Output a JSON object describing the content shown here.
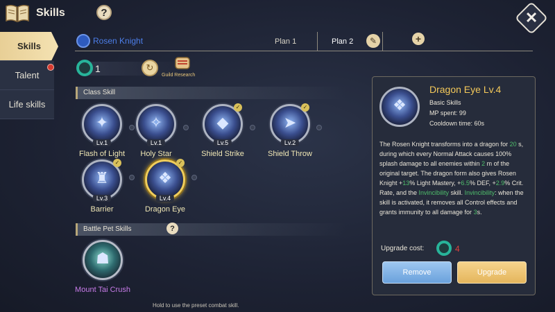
{
  "header": {
    "title": "Skills",
    "help": "?",
    "close": "✕"
  },
  "sidetabs": [
    {
      "label": "Skills"
    },
    {
      "label": "Talent"
    },
    {
      "label": "Life skills"
    }
  ],
  "planbar": {
    "class_name": "Rosen Knight",
    "plan1": "Plan 1",
    "plan2": "Plan 2",
    "edit": "✎",
    "add": "+"
  },
  "points": {
    "value": "1",
    "reset": "↻",
    "guild_label": "Guild Research"
  },
  "sections": {
    "class_skill": "Class Skill",
    "pet_skills": "Battle Pet Skills",
    "pet_help": "?"
  },
  "skills": [
    {
      "name": "Flash of Light",
      "level": "Lv.1",
      "glyph": "✦"
    },
    {
      "name": "Holy Star",
      "level": "Lv.1",
      "glyph": "✧"
    },
    {
      "name": "Shield Strike",
      "level": "Lv.5",
      "glyph": "◆"
    },
    {
      "name": "Shield Throw",
      "level": "Lv.2",
      "glyph": "➤"
    },
    {
      "name": "Barrier",
      "level": "Lv.3",
      "glyph": "♜"
    },
    {
      "name": "Dragon Eye",
      "level": "Lv.4",
      "glyph": "❖"
    }
  ],
  "pet_skill": {
    "name": "Mount Tai Crush",
    "glyph": "☗"
  },
  "check_mark": "✓",
  "hint": "Hold to use the preset combat skill.",
  "detail": {
    "title": "Dragon Eye Lv.4",
    "type": "Basic Skills",
    "mp": "MP spent: 99",
    "cooldown": "Cooldown time: 60s",
    "desc_parts": {
      "p1": "The Rosen Knight transforms into a dragon for ",
      "v1": "20",
      "p2": " s, during which every Normal Attack causes 100% splash damage to all enemies within ",
      "v2": "2",
      "p3": " m of the original target. The dragon form also gives Rosen Knight +",
      "v3": "13",
      "p4": "% Light Mastery, +",
      "v4": "6.5",
      "p5": "% DEF, +",
      "v5": "2.9",
      "p6": "% Crit. Rate, and the ",
      "v6": "Invincibility",
      "p7": " skill. ",
      "v7": "Invincibility",
      "p8": ": when the skill is activated, it removes all Control effects and grants immunity to all damage for ",
      "v8": "3",
      "p9": "s."
    },
    "upgrade_cost_label": "Upgrade cost:",
    "upgrade_cost_value": "4",
    "remove": "Remove",
    "upgrade": "Upgrade",
    "glyph": "❖"
  }
}
